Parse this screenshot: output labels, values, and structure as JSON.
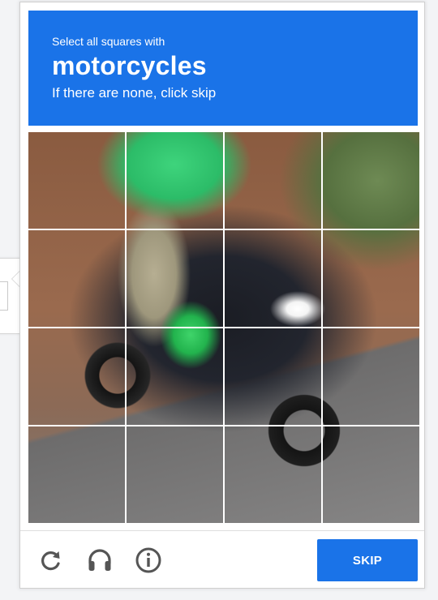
{
  "challenge": {
    "instruction": "Select all squares with",
    "target": "motorcycles",
    "hint": "If there are none, click skip"
  },
  "grid": {
    "rows": 4,
    "cols": 4
  },
  "footer": {
    "reload_icon": "reload-icon",
    "audio_icon": "headphones-icon",
    "info_icon": "info-icon",
    "skip_label": "SKIP"
  },
  "colors": {
    "accent": "#1a73e8",
    "icon": "#555555"
  }
}
